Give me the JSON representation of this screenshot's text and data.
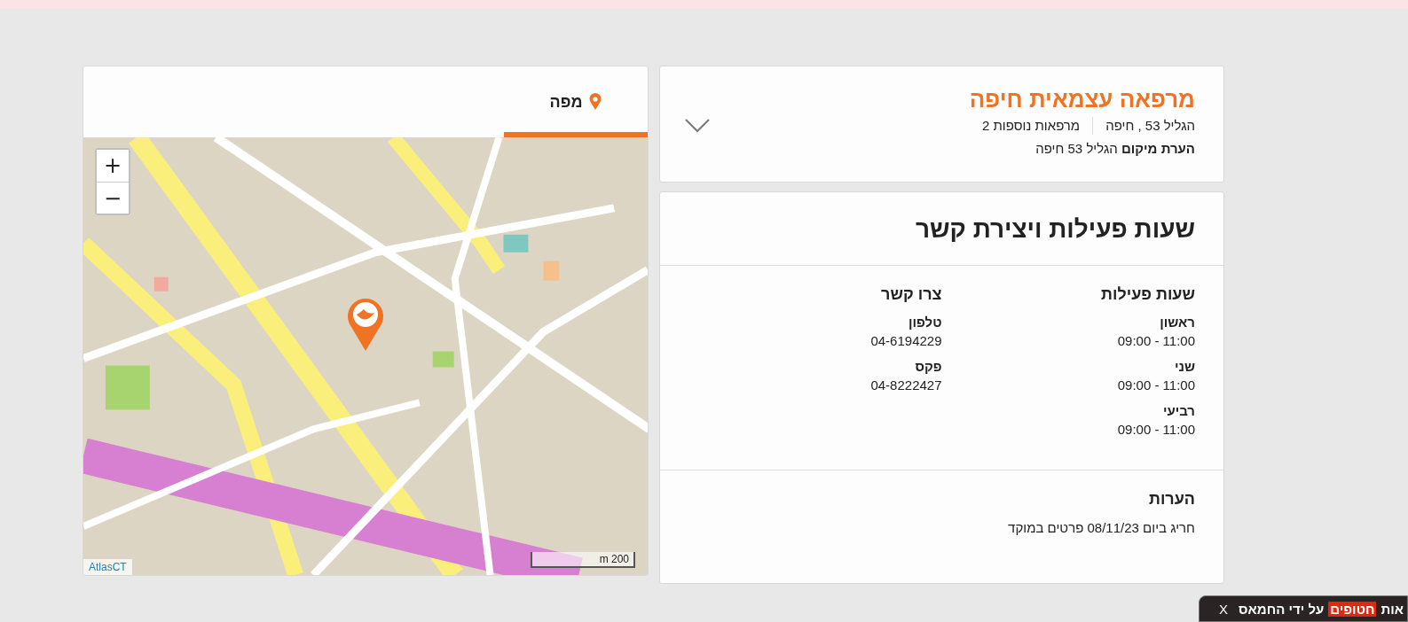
{
  "clinic": {
    "name": "מרפאה עצמאית חיפה",
    "address": "הגליל 53 , חיפה",
    "other_clinics": "מרפאות נוספות 2",
    "location_note": "**הערת מיקום** הגליל 53 חיפה",
    "expanded": false
  },
  "map_panel": {
    "tabs": [
      {
        "label": "מפה",
        "selected": true
      }
    ],
    "zoom_in": "+",
    "zoom_out": "−",
    "attribution": "AtlasCT",
    "scale": "m 200"
  },
  "hours_contact": {
    "title": "שעות פעילות ויצירת קשר",
    "hours_heading": "שעות פעילות",
    "hours": [
      {
        "day": "ראשון",
        "time": "09:00 - 11:00"
      },
      {
        "day": "שני",
        "time": "09:00 - 11:00"
      },
      {
        "day": "רביעי",
        "time": "09:00 - 11:00"
      }
    ],
    "contact_heading": "צרו קשר",
    "contact": [
      {
        "label": "טלפון",
        "value": "04-6194229"
      },
      {
        "label": "פקס",
        "value": "04-8222427"
      }
    ],
    "notes_heading": "הערות",
    "notes": "חריג ביום 08/11/23 פרטים במוקד"
  },
  "banner": {
    "close": "X",
    "parts": [
      {
        "text": "אות",
        "highlight": false
      },
      {
        "text": "חטופים",
        "highlight": true
      },
      {
        "text": "על ידי החמאס",
        "highlight": false
      }
    ]
  }
}
